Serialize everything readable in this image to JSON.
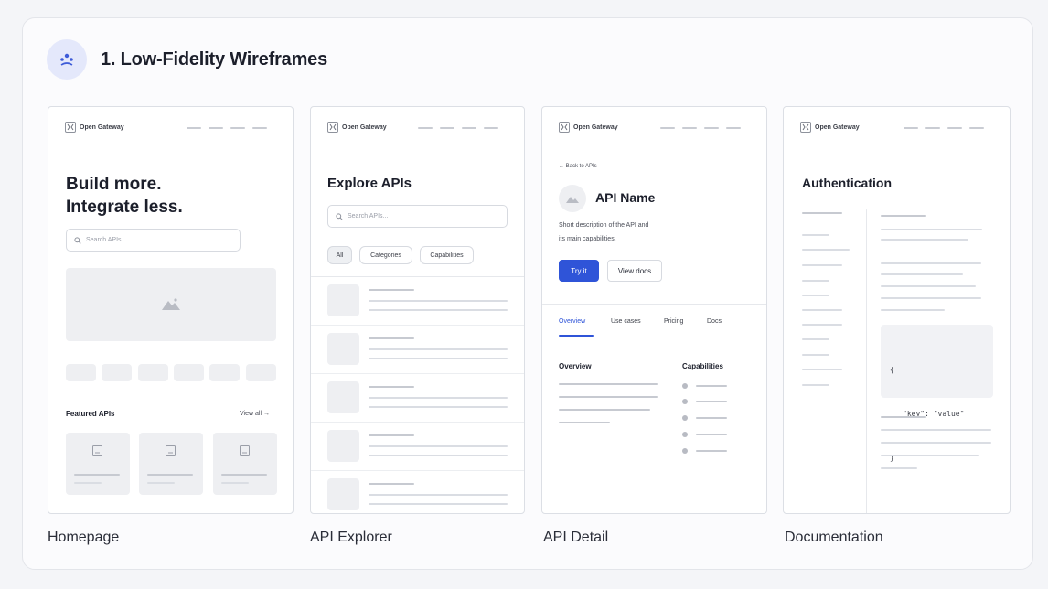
{
  "section": {
    "title": "1. Low-Fidelity Wireframes",
    "icon": "people-group-icon"
  },
  "frames": [
    {
      "caption": "Homepage"
    },
    {
      "caption": "API Explorer"
    },
    {
      "caption": "API Detail"
    },
    {
      "caption": "Documentation"
    }
  ],
  "brand": {
    "logo_text": "Open Gateway"
  },
  "homepage": {
    "headline_1": "Build more.",
    "headline_2": "Integrate less.",
    "search_placeholder": "Search APIs...",
    "featured_title": "Featured APIs",
    "view_all": "View all →"
  },
  "explorer": {
    "title": "Explore APIs",
    "search_placeholder": "Search APIs...",
    "filters": [
      "All",
      "Categories",
      "Capabilities"
    ]
  },
  "detail": {
    "back_link": "← Back to APIs",
    "api_name": "API Name",
    "description_1": "Short description of the API and",
    "description_2": "its main capabilities.",
    "try_button": "Try it",
    "docs_button": "View docs",
    "tabs": [
      "Overview",
      "Use cases",
      "Pricing",
      "Docs"
    ],
    "overview_title": "Overview",
    "capabilities_title": "Capabilities"
  },
  "docs": {
    "title": "Authentication",
    "code_open": "{",
    "code_line": "\"key\": \"value\"",
    "code_close": "}"
  },
  "colors": {
    "accent": "#2f54d8",
    "badge_bg": "#e4e8fb"
  }
}
